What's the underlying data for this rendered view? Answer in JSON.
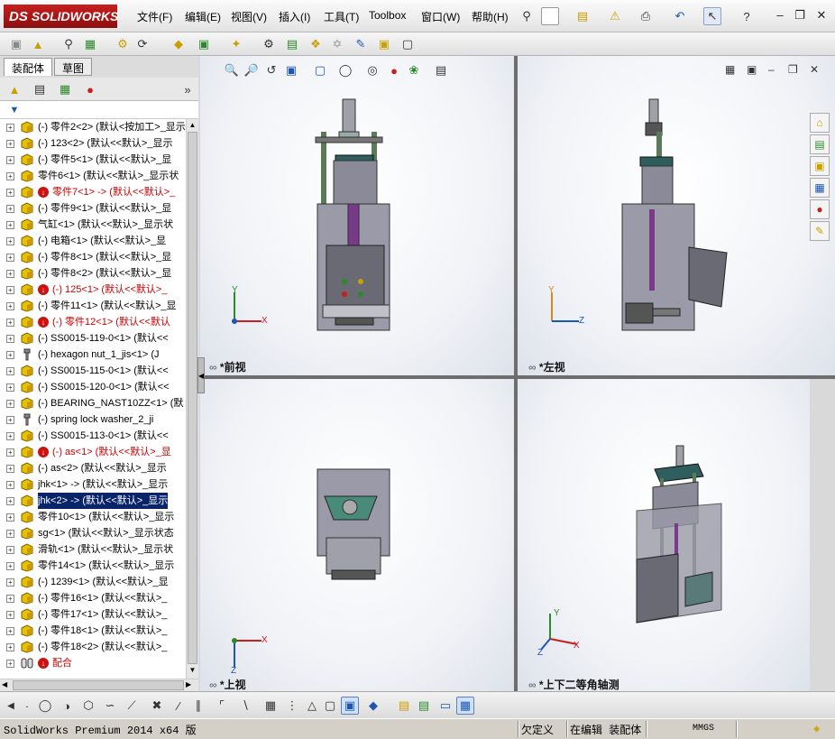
{
  "app": {
    "logo_prefix": "DS",
    "logo_text": "SOLIDWORKS",
    "menus": [
      "文件(F)",
      "编辑(E)",
      "视图(V)",
      "插入(I)",
      "工具(T)",
      "Toolbox",
      "窗口(W)",
      "帮助(H)"
    ],
    "help_icon": "?"
  },
  "panel": {
    "tabs": [
      "装配体",
      "草图"
    ],
    "filter_icon": "funnel-icon",
    "expand": "»"
  },
  "tree": [
    {
      "text": "(-) 零件2<2> (默认<按加工>_显示",
      "state": "normal",
      "icon": "part"
    },
    {
      "text": "(-) 123<2> (默认<<默认>_显示",
      "state": "normal",
      "icon": "part"
    },
    {
      "text": "(-) 零件5<1> (默认<<默认>_显",
      "state": "normal",
      "icon": "part"
    },
    {
      "text": "零件6<1> (默认<<默认>_显示状",
      "state": "normal",
      "icon": "part"
    },
    {
      "text": "零件7<1> -> (默认<<默认>_",
      "state": "error",
      "icon": "part"
    },
    {
      "text": "(-) 零件9<1> (默认<<默认>_显",
      "state": "normal",
      "icon": "part"
    },
    {
      "text": "气缸<1> (默认<<默认>_显示状",
      "state": "normal",
      "icon": "part"
    },
    {
      "text": "(-) 电箱<1> (默认<<默认>_显",
      "state": "normal",
      "icon": "part"
    },
    {
      "text": "(-) 零件8<1> (默认<<默认>_显",
      "state": "normal",
      "icon": "part"
    },
    {
      "text": "(-) 零件8<2> (默认<<默认>_显",
      "state": "normal",
      "icon": "part"
    },
    {
      "text": "(-) 125<1> (默认<<默认>_",
      "state": "error",
      "icon": "part"
    },
    {
      "text": "(-) 零件11<1> (默认<<默认>_显",
      "state": "normal",
      "icon": "part"
    },
    {
      "text": "(-) 零件12<1> (默认<<默认",
      "state": "error",
      "icon": "part"
    },
    {
      "text": "(-) SS0015-119-0<1> (默认<<",
      "state": "normal",
      "icon": "part"
    },
    {
      "text": "(-) hexagon nut_1_jis<1> (J",
      "state": "normal",
      "icon": "bolt"
    },
    {
      "text": "(-) SS0015-115-0<1> (默认<<",
      "state": "normal",
      "icon": "part"
    },
    {
      "text": "(-) SS0015-120-0<1> (默认<<",
      "state": "normal",
      "icon": "part"
    },
    {
      "text": "(-) BEARING_NAST10ZZ<1> (默",
      "state": "normal",
      "icon": "part"
    },
    {
      "text": "(-) spring lock washer_2_ji",
      "state": "normal",
      "icon": "bolt"
    },
    {
      "text": "(-) SS0015-113-0<1> (默认<<",
      "state": "normal",
      "icon": "part"
    },
    {
      "text": "(-) as<1> (默认<<默认>_显",
      "state": "error",
      "icon": "part"
    },
    {
      "text": "(-) as<2> (默认<<默认>_显示",
      "state": "normal",
      "icon": "part"
    },
    {
      "text": "jhk<1> -> (默认<<默认>_显示",
      "state": "normal",
      "icon": "part"
    },
    {
      "text": "jhk<2> -> (默认<<默认>_显示",
      "state": "selected",
      "icon": "part"
    },
    {
      "text": "零件10<1> (默认<<默认>_显示",
      "state": "normal",
      "icon": "part"
    },
    {
      "text": "sg<1> (默认<<默认>_显示状态",
      "state": "normal",
      "icon": "part"
    },
    {
      "text": "滑轨<1> (默认<<默认>_显示状",
      "state": "normal",
      "icon": "part"
    },
    {
      "text": "零件14<1> (默认<<默认>_显示",
      "state": "normal",
      "icon": "part"
    },
    {
      "text": "(-) 1239<1> (默认<<默认>_显",
      "state": "normal",
      "icon": "part"
    },
    {
      "text": "(-) 零件16<1> (默认<<默认>_",
      "state": "normal",
      "icon": "part"
    },
    {
      "text": "(-) 零件17<1> (默认<<默认>_",
      "state": "normal",
      "icon": "part"
    },
    {
      "text": "(-) 零件18<1> (默认<<默认>_",
      "state": "normal",
      "icon": "part"
    },
    {
      "text": "(-) 零件18<2> (默认<<默认>_",
      "state": "normal",
      "icon": "part"
    },
    {
      "text": "配合",
      "state": "error",
      "icon": "mate"
    }
  ],
  "views": {
    "front": "*前视",
    "left": "*左视",
    "top": "*上视",
    "iso": "*上下二等角轴测"
  },
  "axes": {
    "x": "X",
    "y": "Y",
    "z": "Z"
  },
  "status": {
    "product": "SolidWorks Premium 2014 x64 版",
    "undefined": "欠定义",
    "editing": "在编辑 装配体",
    "units": "MMGS"
  },
  "colors": {
    "accent": "#0a246a",
    "error": "#cc0000",
    "logo_red": "#c81e1e"
  }
}
